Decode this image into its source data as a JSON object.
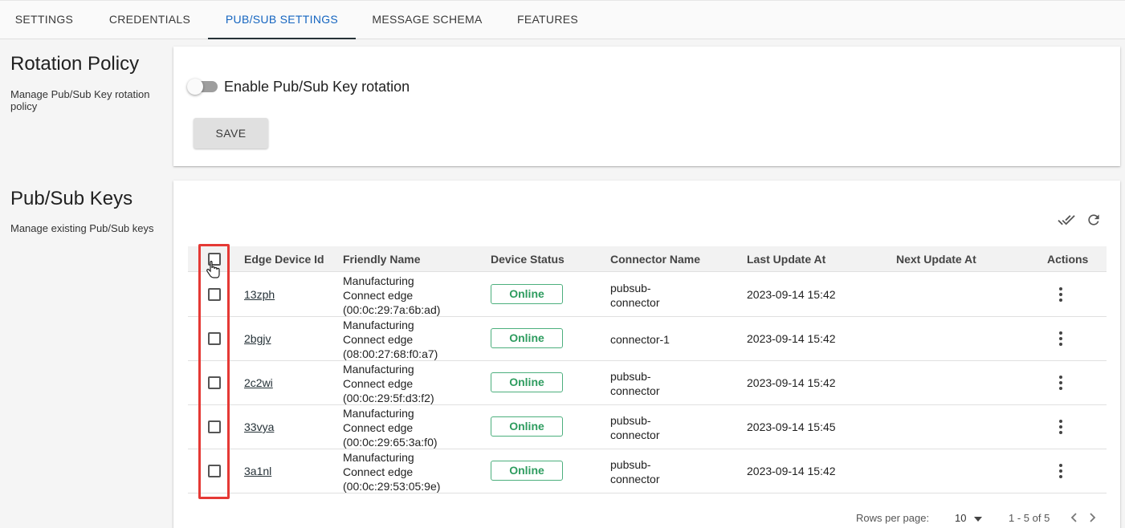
{
  "tabs": [
    {
      "label": "SETTINGS"
    },
    {
      "label": "CREDENTIALS"
    },
    {
      "label": "PUB/SUB SETTINGS"
    },
    {
      "label": "MESSAGE SCHEMA"
    },
    {
      "label": "FEATURES"
    }
  ],
  "rotation_policy": {
    "title": "Rotation Policy",
    "description": "Manage Pub/Sub Key rotation policy",
    "toggle_label": "Enable Pub/Sub Key rotation",
    "toggle_enabled": false,
    "save_label": "SAVE"
  },
  "pubsub_keys": {
    "title": "Pub/Sub Keys",
    "description": "Manage existing Pub/Sub keys",
    "toolbar_icons": [
      "done-all-icon",
      "refresh-icon"
    ],
    "columns": [
      "Edge Device Id",
      "Friendly Name",
      "Device Status",
      "Connector Name",
      "Last Update At",
      "Next Update At",
      "Actions"
    ],
    "rows": [
      {
        "id": "13zph",
        "name_line1": "Manufacturing",
        "name_line2": "Connect edge",
        "name_line3": "(00:0c:29:7a:6b:ad)",
        "status": "Online",
        "conn_line1": "pubsub-",
        "conn_line2": "connector",
        "last_update": "2023-09-14 15:42",
        "next_update": ""
      },
      {
        "id": "2bgjv",
        "name_line1": "Manufacturing",
        "name_line2": "Connect edge",
        "name_line3": "(08:00:27:68:f0:a7)",
        "status": "Online",
        "conn_line1": "connector-1",
        "conn_line2": "",
        "last_update": "2023-09-14 15:42",
        "next_update": ""
      },
      {
        "id": "2c2wi",
        "name_line1": "Manufacturing",
        "name_line2": "Connect edge",
        "name_line3": "(00:0c:29:5f:d3:f2)",
        "status": "Online",
        "conn_line1": "pubsub-",
        "conn_line2": "connector",
        "last_update": "2023-09-14 15:42",
        "next_update": ""
      },
      {
        "id": "33vya",
        "name_line1": "Manufacturing",
        "name_line2": "Connect edge",
        "name_line3": "(00:0c:29:65:3a:f0)",
        "status": "Online",
        "conn_line1": "pubsub-",
        "conn_line2": "connector",
        "last_update": "2023-09-14 15:45",
        "next_update": ""
      },
      {
        "id": "3a1nl",
        "name_line1": "Manufacturing",
        "name_line2": "Connect edge",
        "name_line3": "(00:0c:29:53:05:9e)",
        "status": "Online",
        "conn_line1": "pubsub-",
        "conn_line2": "connector",
        "last_update": "2023-09-14 15:42",
        "next_update": ""
      }
    ],
    "footer": {
      "rows_per_page_label": "Rows per page:",
      "rows_per_page_value": "10",
      "range": "1 - 5 of 5"
    }
  },
  "colors": {
    "active_tab": "#1565c0",
    "online_chip": "#2e9c5f",
    "highlight": "#e53935"
  }
}
